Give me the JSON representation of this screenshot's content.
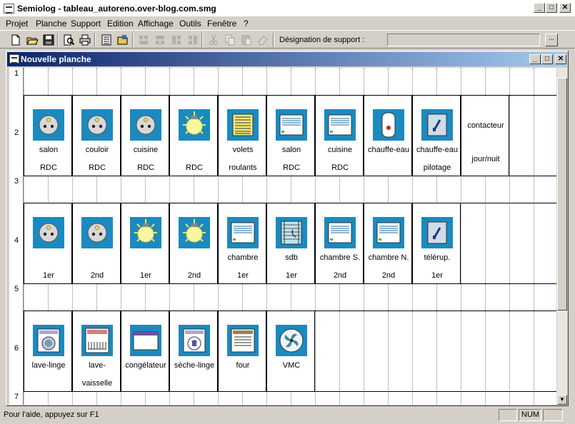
{
  "window": {
    "title": "Semiolog - tableau_autoreno.over-blog.com.smg",
    "controls": {
      "minimize": "_",
      "maximize": "□",
      "close": "✕"
    }
  },
  "menu": {
    "items": [
      "Projet",
      "Planche",
      "Support",
      "Edition",
      "Affichage",
      "Outils",
      "Fenêtre",
      "?"
    ]
  },
  "toolbar": {
    "icons": [
      "new-icon",
      "open-icon",
      "save-icon",
      "print-preview-icon",
      "print-icon",
      "grid-icon",
      "folder-open-icon",
      "layout-icon",
      "layout-icon",
      "layout-icon",
      "layout-icon",
      "cut-icon",
      "copy-icon",
      "paste-icon",
      "eraser-icon"
    ],
    "designation_label": "Désignation de support :",
    "designation_value": "",
    "browse_label": "..."
  },
  "child_window": {
    "title": "Nouvelle planche",
    "controls": {
      "minimize": "_",
      "maximize": "□",
      "close": "✕"
    }
  },
  "grid": {
    "row_numbers": [
      "1",
      "2",
      "3",
      "4",
      "5",
      "6",
      "7"
    ],
    "rows": [
      [
        {
          "icon": "socket-icon",
          "line1": "salon",
          "line2": "RDC"
        },
        {
          "icon": "socket-icon",
          "line1": "couloir",
          "line2": "RDC"
        },
        {
          "icon": "socket-icon",
          "line1": "cuisine",
          "line2": "RDC"
        },
        {
          "icon": "lightbulb-icon",
          "line1": "",
          "line2": "RDC"
        },
        {
          "icon": "shutters-icon",
          "line1": "volets",
          "line2": "roulants"
        },
        {
          "icon": "radiator-icon",
          "line1": "salon",
          "line2": "RDC"
        },
        {
          "icon": "radiator-icon",
          "line1": "cuisine",
          "line2": "RDC"
        },
        {
          "icon": "water-heater-icon",
          "line1": "chauffe-eau",
          "line2": ""
        },
        {
          "icon": "switch-icon",
          "line1": "chauffe-eau",
          "line2": "pilotage"
        },
        {
          "icon": "",
          "line1": "contacteur",
          "line2": "jour/nuit"
        }
      ],
      [
        {
          "icon": "socket-icon",
          "line1": "",
          "line2": "1er"
        },
        {
          "icon": "socket-icon",
          "line1": "",
          "line2": "2nd"
        },
        {
          "icon": "lightbulb-icon",
          "line1": "",
          "line2": "1er"
        },
        {
          "icon": "lightbulb-icon",
          "line1": "",
          "line2": "2nd"
        },
        {
          "icon": "radiator-icon",
          "line1": "chambre",
          "line2": "1er"
        },
        {
          "icon": "towel-radiator-icon",
          "line1": "sdb",
          "line2": "1er"
        },
        {
          "icon": "radiator-icon",
          "line1": "chambre S.",
          "line2": "2nd"
        },
        {
          "icon": "radiator-icon",
          "line1": "chambre N.",
          "line2": "2nd"
        },
        {
          "icon": "switch-icon",
          "line1": "télérup.",
          "line2": "1er"
        }
      ],
      [
        {
          "icon": "washing-machine-icon",
          "line1": "lave-linge",
          "line2": ""
        },
        {
          "icon": "dishwasher-icon",
          "line1": "lave-",
          "line2": "vaisselle"
        },
        {
          "icon": "freezer-icon",
          "line1": "congélateur",
          "line2": ""
        },
        {
          "icon": "dryer-icon",
          "line1": "sèche-linge",
          "line2": ""
        },
        {
          "icon": "oven-icon",
          "line1": "four",
          "line2": ""
        },
        {
          "icon": "fan-icon",
          "line1": "VMC",
          "line2": ""
        }
      ]
    ]
  },
  "status": {
    "help_text": "Pour l'aide, appuyez sur F1",
    "panel1": "",
    "num": "NUM",
    "panel3": ""
  },
  "colors": {
    "icon_bg": "#1b8ac0",
    "title_active_start": "#0a246a",
    "title_active_end": "#a6caf0"
  }
}
